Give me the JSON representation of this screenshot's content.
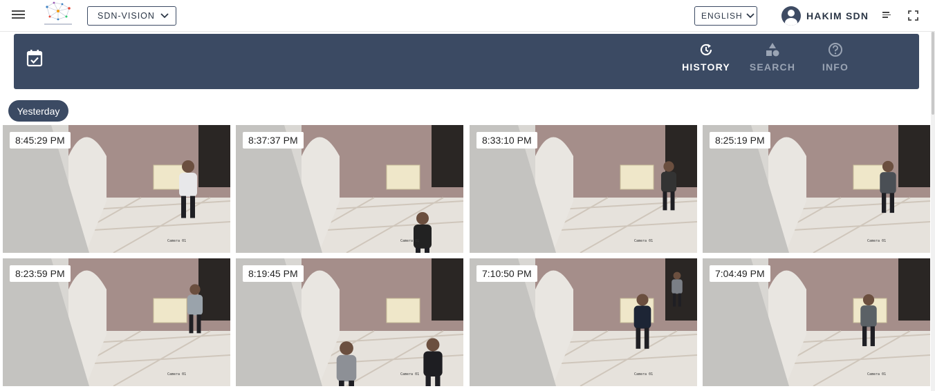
{
  "header": {
    "project": "SDN-VISION",
    "language": "ENGLISH",
    "user_name": "HAKIM SDN"
  },
  "toolbar": {
    "history_label": "HISTORY",
    "search_label": "SEARCH",
    "info_label": "INFO",
    "active_tab": "HISTORY"
  },
  "day_label": "Yesterday",
  "snapshots": [
    {
      "time": "8:45:29 PM",
      "camera": "Camera 01"
    },
    {
      "time": "8:37:37 PM",
      "camera": "Camera 01"
    },
    {
      "time": "8:33:10 PM",
      "camera": "Camera 01"
    },
    {
      "time": "8:25:19 PM",
      "camera": "Camera 01"
    },
    {
      "time": "8:23:59 PM",
      "camera": "Camera 01"
    },
    {
      "time": "8:19:45 PM",
      "camera": "Camera 01"
    },
    {
      "time": "7:10:50 PM",
      "camera": "Camera 01"
    },
    {
      "time": "7:04:49 PM",
      "camera": "Camera 01"
    }
  ],
  "colors": {
    "panel": "#3b4a63",
    "active_nav": "#ffffff",
    "inactive_nav": "#9aa4b4"
  }
}
